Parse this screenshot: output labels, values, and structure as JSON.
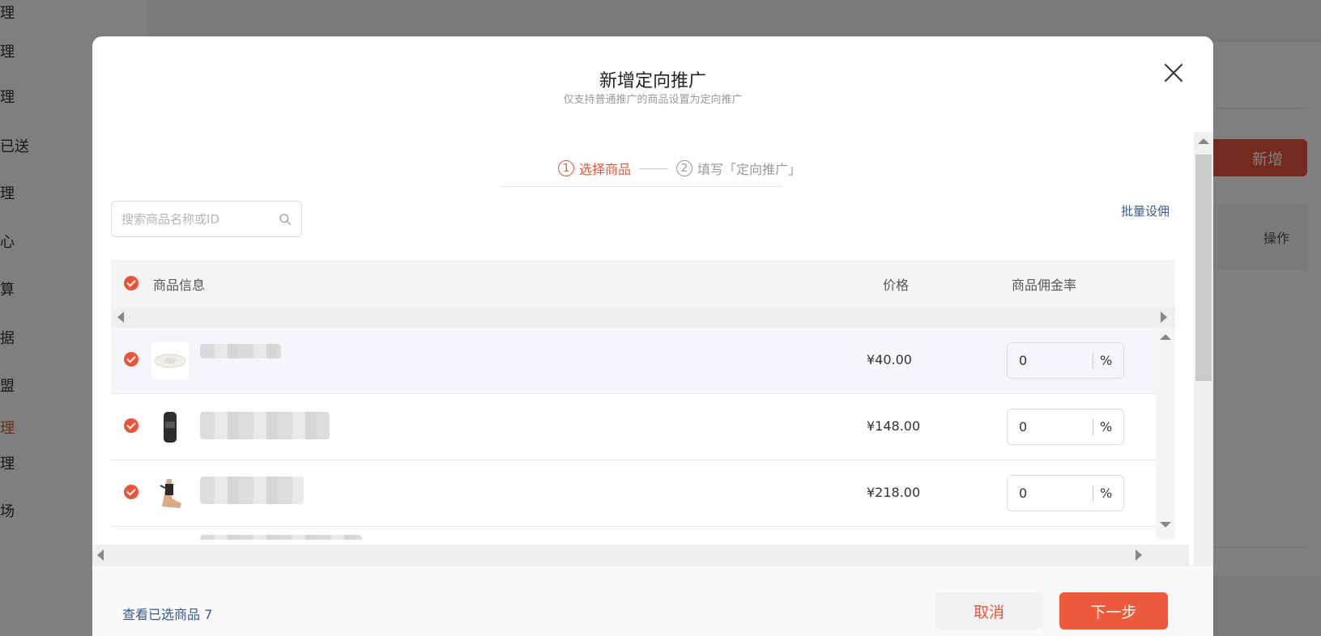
{
  "background": {
    "sidebar_items": [
      {
        "label": "理",
        "active": false
      },
      {
        "label": "理",
        "active": false
      },
      {
        "label": "理",
        "active": false
      },
      {
        "label": "已送",
        "active": false
      },
      {
        "label": "理",
        "active": false
      },
      {
        "label": "心",
        "active": false
      },
      {
        "label": "算",
        "active": false
      },
      {
        "label": "据",
        "active": false
      },
      {
        "label": "盟",
        "active": false
      },
      {
        "label": "理",
        "active": true
      },
      {
        "label": "理",
        "active": false
      },
      {
        "label": "场",
        "active": false
      }
    ],
    "new_button": "新增",
    "ops_header": "操作"
  },
  "modal": {
    "title": "新增定向推广",
    "subtitle": "仅支持普通推广的商品设置为定向推广",
    "steps": [
      {
        "num": "1",
        "label": "选择商品",
        "active": true
      },
      {
        "num": "2",
        "label": "填写「定向推广」",
        "active": false
      }
    ],
    "search": {
      "placeholder": "搜索商品名称或ID",
      "value": ""
    },
    "batch_link": "批量设佣",
    "table": {
      "headers": {
        "info": "商品信息",
        "price": "价格",
        "rate": "商品佣金率"
      },
      "rows": [
        {
          "price": "¥40.00",
          "rate": "0",
          "unit": "%",
          "thumb": "white-device-icon",
          "checked": true
        },
        {
          "price": "¥148.00",
          "rate": "0",
          "unit": "%",
          "thumb": "black-brace-icon",
          "checked": true
        },
        {
          "price": "¥218.00",
          "rate": "0",
          "unit": "%",
          "thumb": "ankle-brace-icon",
          "checked": true
        },
        {
          "price": "",
          "rate": "",
          "unit": "%",
          "thumb": "",
          "checked": true
        }
      ]
    },
    "footer": {
      "view_selected": "查看已选商品 7",
      "cancel": "取消",
      "next": "下一步"
    }
  },
  "colors": {
    "accent": "#e8553a",
    "link": "#3a5a8c"
  }
}
